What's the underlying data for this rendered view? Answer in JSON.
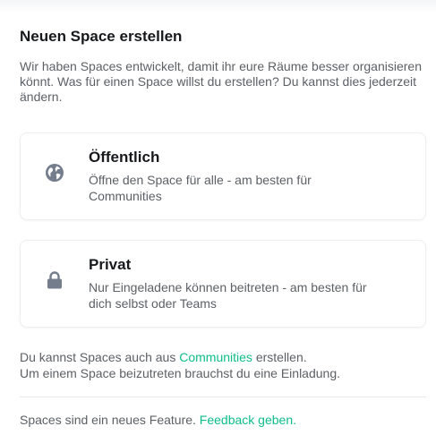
{
  "dialog": {
    "title": "Neuen Space erstellen",
    "intro": "Wir haben Spaces entwickelt, damit ihr eure Räume besser organisieren könnt. Was für einen Space willst du erstellen? Du kannst dies jederzeit ändern."
  },
  "options": [
    {
      "icon": "globe-icon",
      "title": "Öffentlich",
      "description": "Öffne den Space für alle - am besten für Communities"
    },
    {
      "icon": "lock-icon",
      "title": "Privat",
      "description": "Nur Eingeladene können beitreten - am besten für dich selbst oder Teams"
    }
  ],
  "footer": {
    "line1_prefix": "Du kannst Spaces auch aus ",
    "line1_link": "Communities",
    "line1_suffix": " erstellen.",
    "line2": "Um einem Space beizutreten brauchst du eine Einladung."
  },
  "feedback": {
    "text": "Spaces sind ein neues Feature. ",
    "link": "Feedback geben."
  },
  "colors": {
    "accent": "#0dbd8b",
    "icon": "#737d8c",
    "text_primary": "#17191c",
    "text_secondary": "#5c6166"
  }
}
